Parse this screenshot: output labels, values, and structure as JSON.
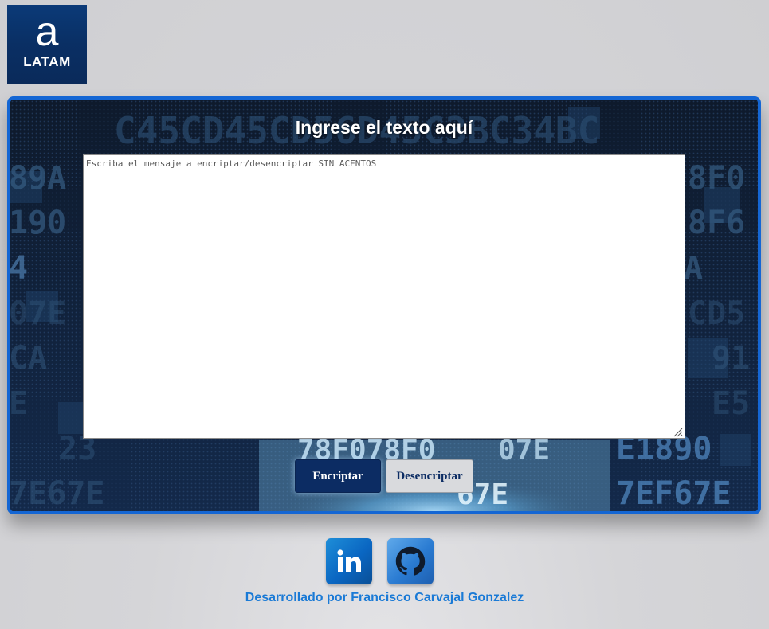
{
  "brand": {
    "logo_mark": "a",
    "logo_text": "LATAM"
  },
  "panel": {
    "title": "Ingrese el texto aquí",
    "textarea": {
      "value": "",
      "placeholder": "Escriba el mensaje a encriptar/desencriptar SIN ACENTOS"
    },
    "buttons": {
      "encrypt_label": "Encriptar",
      "decrypt_label": "Desencriptar"
    }
  },
  "footer": {
    "social": [
      {
        "name": "linkedin",
        "icon": "linkedin-icon"
      },
      {
        "name": "github",
        "icon": "github-icon"
      }
    ],
    "credit": "Desarrollado por Francisco Carvajal Gonzalez"
  },
  "colors": {
    "brand_navy": "#0c2c63",
    "panel_border": "#1466d4",
    "credit_text": "#1a7ad6",
    "linkedin": "#0a66c2",
    "github": "#2a7bd2"
  },
  "background_glyphs": "C45CD45CD56D45C3BC34BC"
}
